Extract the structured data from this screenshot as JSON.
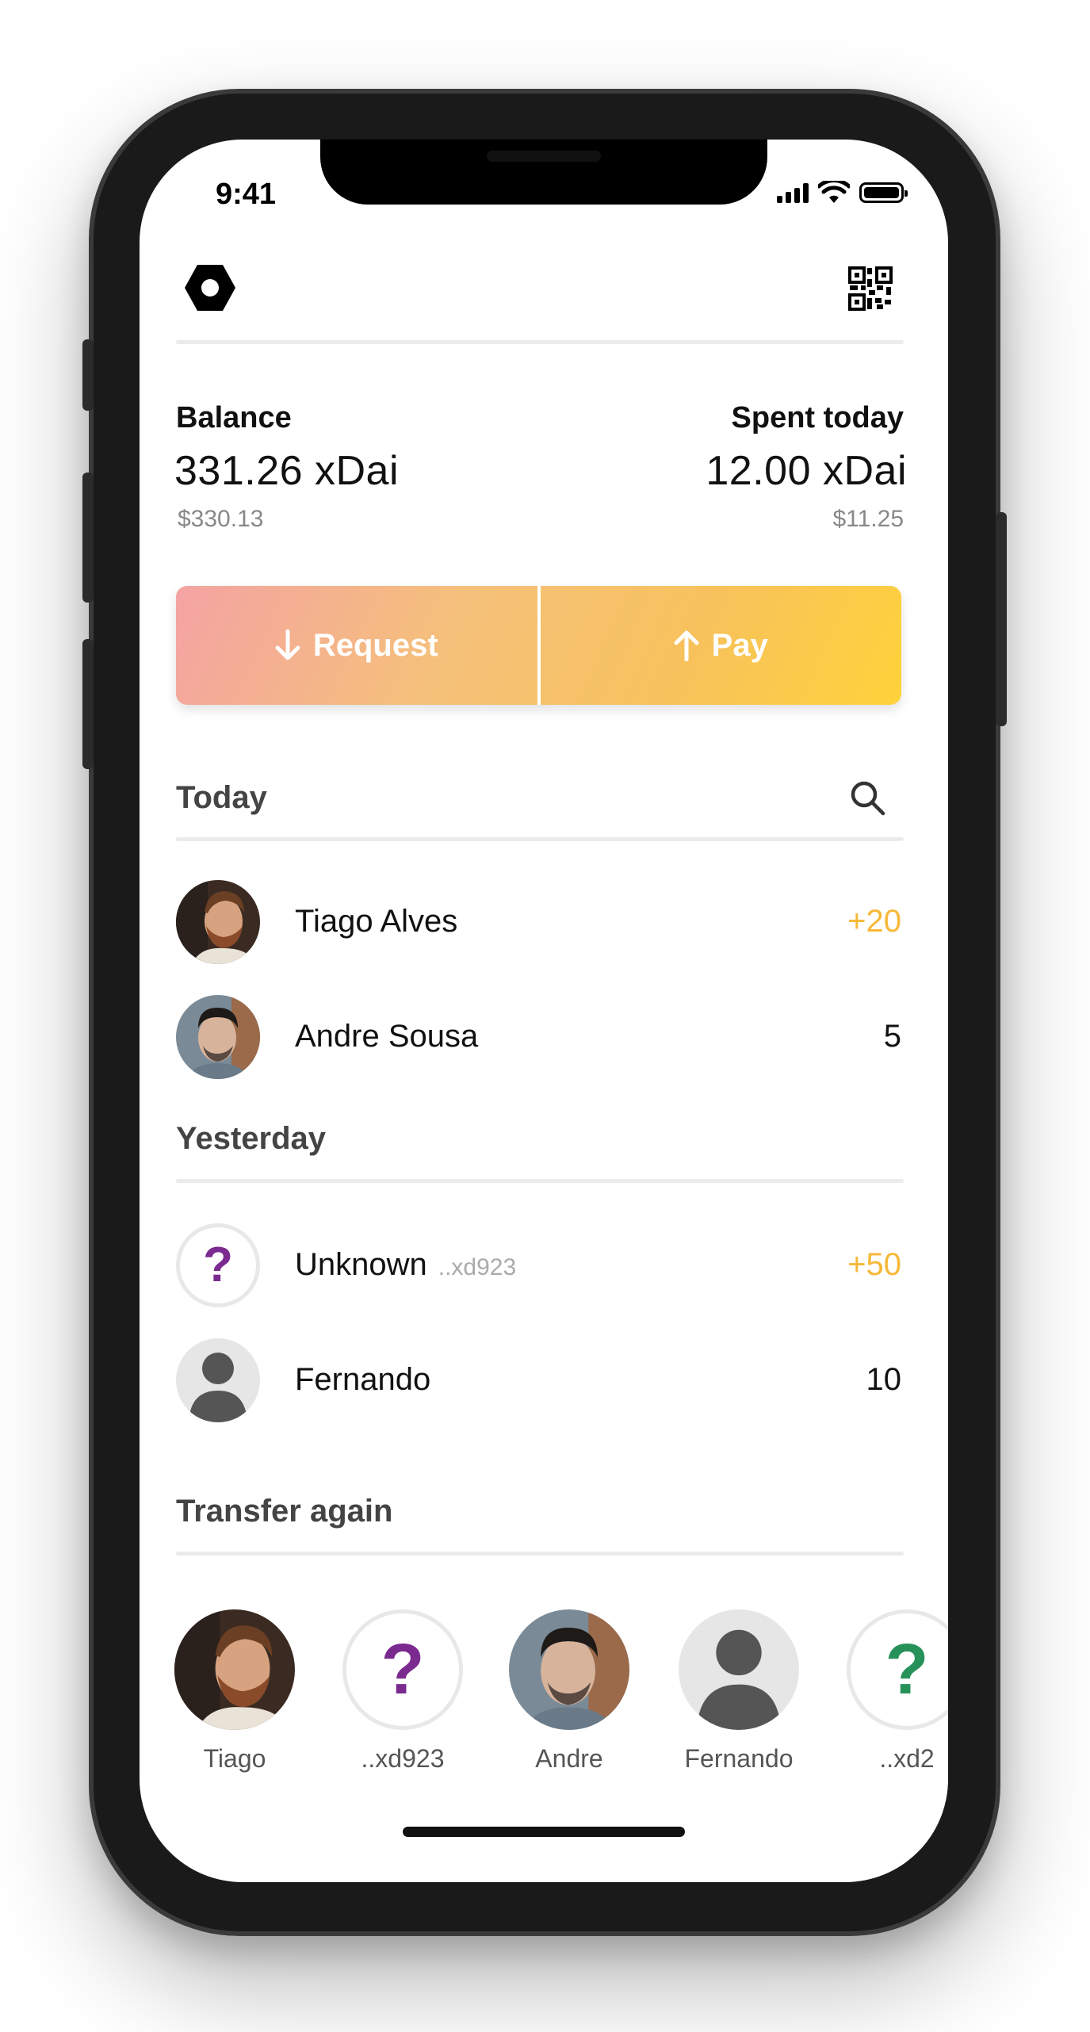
{
  "status": {
    "time": "9:41"
  },
  "balance": {
    "label": "Balance",
    "amount": "331.26 xDai",
    "fiat": "$330.13"
  },
  "spent": {
    "label": "Spent today",
    "amount": "12.00 xDai",
    "fiat": "$11.25"
  },
  "actions": {
    "request_label": "Request",
    "pay_label": "Pay"
  },
  "sections": {
    "today": "Today",
    "yesterday": "Yesterday",
    "transfer_again": "Transfer again"
  },
  "today_rows": [
    {
      "name": "Tiago Alves",
      "amount": "+20"
    },
    {
      "name": "Andre Sousa",
      "amount": "5"
    }
  ],
  "yesterday_rows": [
    {
      "name": "Unknown",
      "sub": "..xd923",
      "amount": "+50"
    },
    {
      "name": "Fernando",
      "amount": "10"
    }
  ],
  "transfer_again": [
    {
      "label": "Tiago",
      "avatar": "photo"
    },
    {
      "label": "..xd923",
      "avatar": "unknown"
    },
    {
      "label": "Andre",
      "avatar": "photo"
    },
    {
      "label": "Fernando",
      "avatar": "default-person"
    },
    {
      "label": "..xd2",
      "avatar": "unknown"
    }
  ],
  "colors": {
    "positive_amount": "#f7b838",
    "unknown_purple": "#7b2a8f",
    "unknown_green": "#27915a"
  },
  "icons": {
    "settings": "hexagon-settings-icon",
    "qr": "qr-code-icon",
    "search": "search-icon",
    "request": "arrow-down-icon",
    "pay": "arrow-up-icon"
  }
}
